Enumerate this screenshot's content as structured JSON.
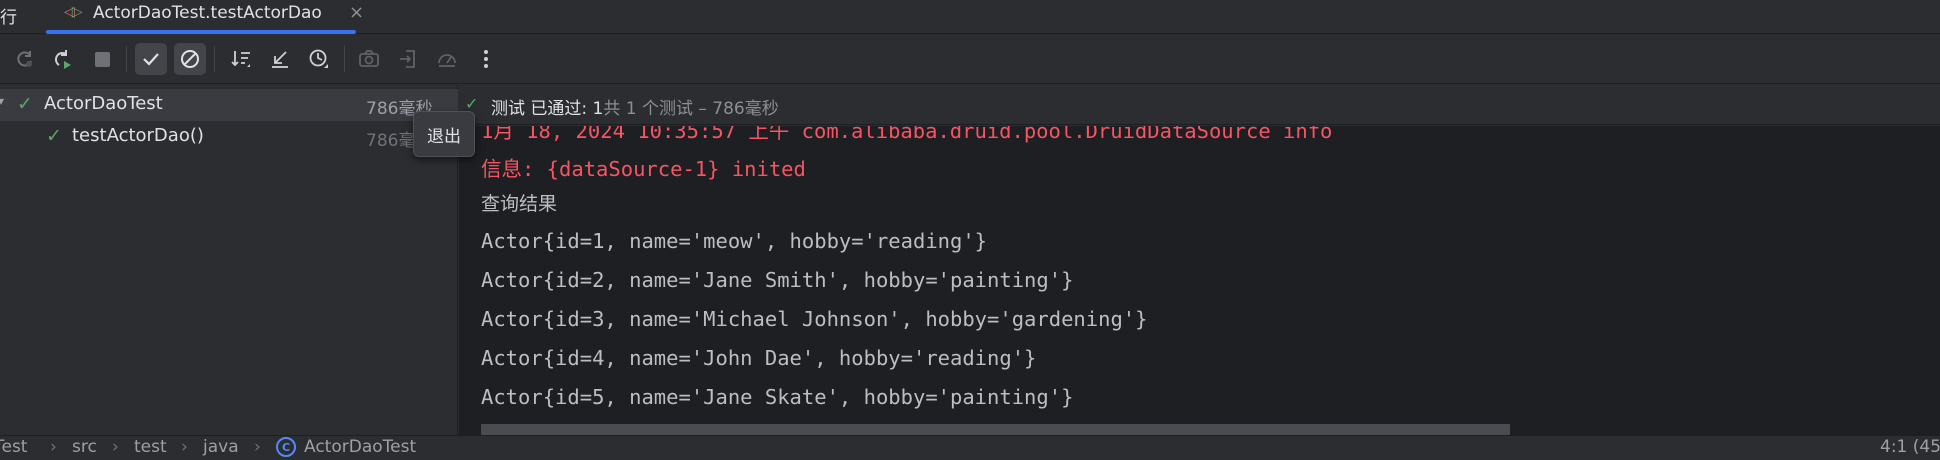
{
  "tabbar": {
    "run_label": "运行",
    "tab_title": "ActorDaoTest.testActorDao",
    "close_glyph": "×"
  },
  "toolbar": {
    "icons": [
      "rerun-icon",
      "rerun-failed-icon",
      "stop-icon",
      "show-passed-icon",
      "show-ignored-icon",
      "sort-icon",
      "import-tests-icon",
      "history-icon",
      "screenshot-icon",
      "export-icon",
      "coverage-icon",
      "more-icon"
    ]
  },
  "tree": {
    "items": [
      {
        "name": "ActorDaoTest",
        "time": "786毫秒",
        "status": "passed"
      },
      {
        "name": "testActorDao()",
        "time": "786毫",
        "status": "passed"
      }
    ]
  },
  "tooltip": {
    "text": "退出"
  },
  "status": {
    "prefix": "测试 已通过: 1",
    "suffix": "共 1 个测试 – 786毫秒"
  },
  "console": {
    "lines": [
      "1月 18, 2024 10:35:57 上午 com.alibaba.druid.pool.DruidDataSource info",
      "信息: {dataSource-1} inited",
      "查询结果",
      "Actor{id=1, name='meow', hobby='reading'}",
      "Actor{id=2, name='Jane Smith', hobby='painting'}",
      "Actor{id=3, name='Michael Johnson', hobby='gardening'}",
      "Actor{id=4, name='John Dae', hobby='reading'}",
      "Actor{id=5, name='Jane Skate', hobby='painting'}"
    ]
  },
  "breadcrumb": {
    "items": [
      "Test",
      "src",
      "test",
      "java",
      "ActorDaoTest"
    ],
    "separator": "›",
    "position": "4:1 (45"
  },
  "colors": {
    "accent": "#3574f0",
    "passed": "#59a869",
    "error_text": "#f75464"
  }
}
